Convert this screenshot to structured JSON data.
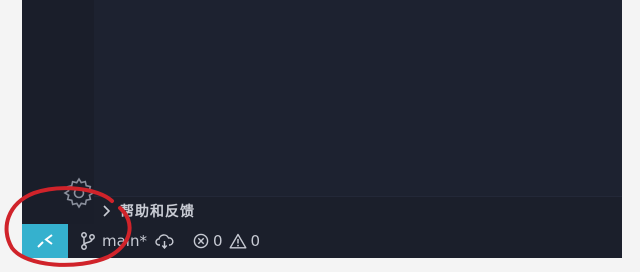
{
  "sidebar": {
    "help_section": {
      "label": "帮助和反馈",
      "collapsed": true
    }
  },
  "status_bar": {
    "remote_icon": "remote-indicator-icon",
    "branch": "main*",
    "errors": "0",
    "warnings": "0"
  },
  "colors": {
    "background": "#1b1f2b",
    "remote_button": "#35b1ce",
    "text": "#c7cad3",
    "annotation": "#d0232a"
  }
}
